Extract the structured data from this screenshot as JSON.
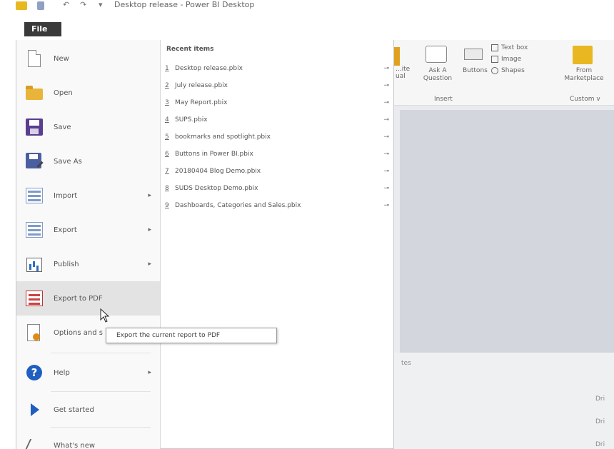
{
  "window": {
    "title": "Desktop release - Power BI Desktop",
    "undo_glyph": "↶",
    "redo_glyph": "↷",
    "dropdown_glyph": "▾"
  },
  "file_tab": {
    "label": "File"
  },
  "file_menu": {
    "items": [
      {
        "label": "New",
        "icon": "new-document-icon",
        "has_submenu": false
      },
      {
        "label": "Open",
        "icon": "open-folder-icon",
        "has_submenu": false
      },
      {
        "label": "Save",
        "icon": "save-icon",
        "has_submenu": false
      },
      {
        "label": "Save As",
        "icon": "save-as-icon",
        "has_submenu": false
      },
      {
        "label": "Import",
        "icon": "import-icon",
        "has_submenu": true
      },
      {
        "label": "Export",
        "icon": "export-icon",
        "has_submenu": true
      },
      {
        "label": "Publish",
        "icon": "publish-icon",
        "has_submenu": true
      },
      {
        "label": "Export to PDF",
        "icon": "pdf-icon",
        "has_submenu": false,
        "highlighted": true
      },
      {
        "label": "Options and s",
        "icon": "options-icon",
        "has_submenu": false
      },
      {
        "label": "Help",
        "icon": "help-icon",
        "has_submenu": true
      },
      {
        "label": "Get started",
        "icon": "get-started-icon",
        "has_submenu": false
      },
      {
        "label": "What's new",
        "icon": "whats-new-icon",
        "has_submenu": false
      }
    ],
    "submenu_arrow": "▸",
    "recent": {
      "title": "Recent items",
      "pin_glyph": "⊸",
      "items": [
        {
          "num": "1",
          "name": "Desktop release.pbix"
        },
        {
          "num": "2",
          "name": "July release.pbix"
        },
        {
          "num": "3",
          "name": "May Report.pbix"
        },
        {
          "num": "4",
          "name": "SUPS.pbix"
        },
        {
          "num": "5",
          "name": "bookmarks and spotlight.pbix"
        },
        {
          "num": "6",
          "name": "Buttons in Power BI.pbix"
        },
        {
          "num": "7",
          "name": "20180404 Blog Demo.pbix"
        },
        {
          "num": "8",
          "name": "SUDS Desktop Demo.pbix"
        },
        {
          "num": "9",
          "name": "Dashboards, Categories and Sales.pbix"
        }
      ]
    }
  },
  "tooltip": {
    "text": "Export the current report to PDF"
  },
  "ribbon": {
    "visual_label": "ual",
    "new_label": "...ite",
    "ask_label": "Ask A Question",
    "buttons_label": "Buttons",
    "text_box": "Text box",
    "image": "Image",
    "shapes": "Shapes",
    "insert_group": "Insert",
    "marketplace": "From Marketplace",
    "custom_group": "Custom v"
  },
  "canvas": {
    "label_left": "tes",
    "label_right_1": "Dri",
    "label_right_2": "Dri",
    "label_right_3": "Dri"
  }
}
